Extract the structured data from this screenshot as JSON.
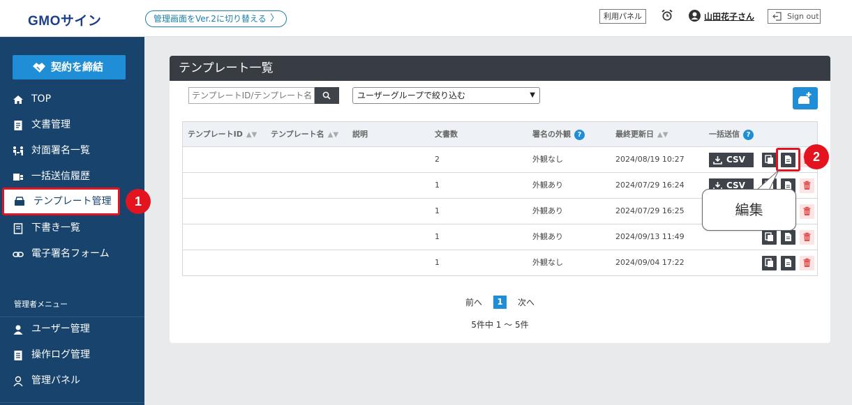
{
  "header": {
    "logo": "GMOサイン",
    "switch_version": "管理画面をVer.2に切り替える",
    "switch_chevron": "〉",
    "admin_panel": "利用パネル",
    "user_name": "山田花子さん",
    "sign_out": "Sign out"
  },
  "sidebar": {
    "contract_button": "契約を締結",
    "items": [
      {
        "label": "TOP",
        "icon": "home-icon"
      },
      {
        "label": "文書管理",
        "icon": "document-icon"
      },
      {
        "label": "対面署名一覧",
        "icon": "face-to-face-icon"
      },
      {
        "label": "一括送信履歴",
        "icon": "bulk-send-icon"
      },
      {
        "label": "テンプレート管理",
        "icon": "template-icon"
      },
      {
        "label": "下書き一覧",
        "icon": "draft-icon"
      },
      {
        "label": "電子署名フォーム",
        "icon": "link-icon"
      }
    ],
    "admin_menu_label": "管理者メニュー",
    "admin_items": [
      {
        "label": "ユーザー管理",
        "icon": "user-icon"
      },
      {
        "label": "操作ログ管理",
        "icon": "log-icon"
      },
      {
        "label": "管理パネル",
        "icon": "panel-icon"
      }
    ]
  },
  "annotations": {
    "badge1": "1",
    "badge2": "2",
    "tooltip": "編集"
  },
  "main": {
    "title": "テンプレート一覧",
    "search_placeholder": "テンプレートID/テンプレート名",
    "group_filter": "ユーザーグループで絞り込む",
    "columns": [
      "テンプレートID",
      "テンプレート名",
      "説明",
      "文書数",
      "署名の外観",
      "最終更新日",
      "一括送信"
    ],
    "csv_label": "CSV",
    "rows": [
      {
        "id": "",
        "name": "",
        "desc": "",
        "count": "2",
        "appearance": "外観なし",
        "updated": "2024/08/19 10:27",
        "bulk": true
      },
      {
        "id": "",
        "name": "",
        "desc": "",
        "count": "1",
        "appearance": "外観あり",
        "updated": "2024/07/29 16:24",
        "bulk": true
      },
      {
        "id": "",
        "name": "",
        "desc": "",
        "count": "1",
        "appearance": "外観あり",
        "updated": "2024/07/29 16:25",
        "bulk": false
      },
      {
        "id": "",
        "name": "",
        "desc": "",
        "count": "1",
        "appearance": "外観あり",
        "updated": "2024/09/13 11:49",
        "bulk": false
      },
      {
        "id": "",
        "name": "",
        "desc": "",
        "count": "1",
        "appearance": "外観なし",
        "updated": "2024/09/04 17:22",
        "bulk": false
      }
    ],
    "pagination": {
      "prev": "前へ",
      "current": "1",
      "next": "次へ",
      "summary": "5件中 1 ～ 5件"
    }
  },
  "colors": {
    "sidebar_bg": "#17436c",
    "accent_blue": "#1f8ed6",
    "highlight_red": "#e3141f",
    "card_header": "#383d44"
  }
}
